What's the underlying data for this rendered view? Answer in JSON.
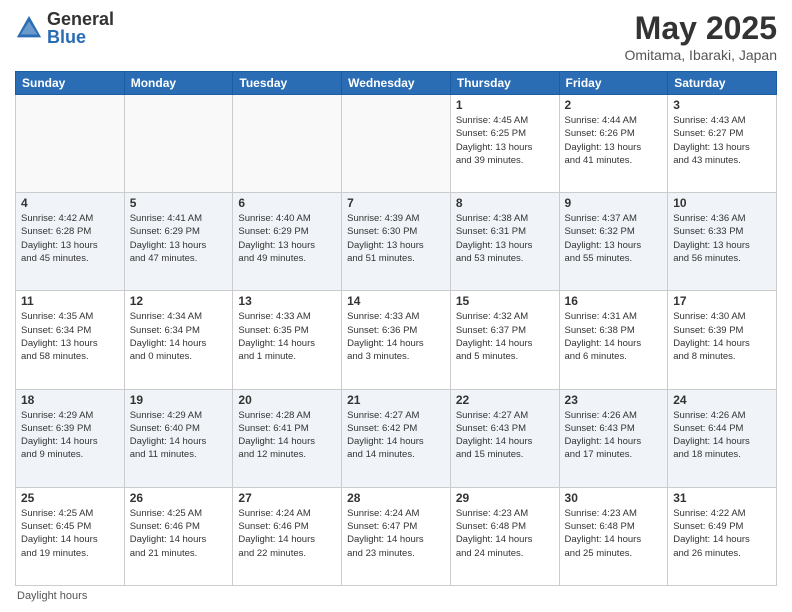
{
  "header": {
    "logo": {
      "general": "General",
      "blue": "Blue"
    },
    "title": "May 2025",
    "location": "Omitama, Ibaraki, Japan"
  },
  "days_of_week": [
    "Sunday",
    "Monday",
    "Tuesday",
    "Wednesday",
    "Thursday",
    "Friday",
    "Saturday"
  ],
  "weeks": [
    [
      {
        "day": "",
        "info": ""
      },
      {
        "day": "",
        "info": ""
      },
      {
        "day": "",
        "info": ""
      },
      {
        "day": "",
        "info": ""
      },
      {
        "day": "1",
        "info": "Sunrise: 4:45 AM\nSunset: 6:25 PM\nDaylight: 13 hours\nand 39 minutes."
      },
      {
        "day": "2",
        "info": "Sunrise: 4:44 AM\nSunset: 6:26 PM\nDaylight: 13 hours\nand 41 minutes."
      },
      {
        "day": "3",
        "info": "Sunrise: 4:43 AM\nSunset: 6:27 PM\nDaylight: 13 hours\nand 43 minutes."
      }
    ],
    [
      {
        "day": "4",
        "info": "Sunrise: 4:42 AM\nSunset: 6:28 PM\nDaylight: 13 hours\nand 45 minutes."
      },
      {
        "day": "5",
        "info": "Sunrise: 4:41 AM\nSunset: 6:29 PM\nDaylight: 13 hours\nand 47 minutes."
      },
      {
        "day": "6",
        "info": "Sunrise: 4:40 AM\nSunset: 6:29 PM\nDaylight: 13 hours\nand 49 minutes."
      },
      {
        "day": "7",
        "info": "Sunrise: 4:39 AM\nSunset: 6:30 PM\nDaylight: 13 hours\nand 51 minutes."
      },
      {
        "day": "8",
        "info": "Sunrise: 4:38 AM\nSunset: 6:31 PM\nDaylight: 13 hours\nand 53 minutes."
      },
      {
        "day": "9",
        "info": "Sunrise: 4:37 AM\nSunset: 6:32 PM\nDaylight: 13 hours\nand 55 minutes."
      },
      {
        "day": "10",
        "info": "Sunrise: 4:36 AM\nSunset: 6:33 PM\nDaylight: 13 hours\nand 56 minutes."
      }
    ],
    [
      {
        "day": "11",
        "info": "Sunrise: 4:35 AM\nSunset: 6:34 PM\nDaylight: 13 hours\nand 58 minutes."
      },
      {
        "day": "12",
        "info": "Sunrise: 4:34 AM\nSunset: 6:34 PM\nDaylight: 14 hours\nand 0 minutes."
      },
      {
        "day": "13",
        "info": "Sunrise: 4:33 AM\nSunset: 6:35 PM\nDaylight: 14 hours\nand 1 minute."
      },
      {
        "day": "14",
        "info": "Sunrise: 4:33 AM\nSunset: 6:36 PM\nDaylight: 14 hours\nand 3 minutes."
      },
      {
        "day": "15",
        "info": "Sunrise: 4:32 AM\nSunset: 6:37 PM\nDaylight: 14 hours\nand 5 minutes."
      },
      {
        "day": "16",
        "info": "Sunrise: 4:31 AM\nSunset: 6:38 PM\nDaylight: 14 hours\nand 6 minutes."
      },
      {
        "day": "17",
        "info": "Sunrise: 4:30 AM\nSunset: 6:39 PM\nDaylight: 14 hours\nand 8 minutes."
      }
    ],
    [
      {
        "day": "18",
        "info": "Sunrise: 4:29 AM\nSunset: 6:39 PM\nDaylight: 14 hours\nand 9 minutes."
      },
      {
        "day": "19",
        "info": "Sunrise: 4:29 AM\nSunset: 6:40 PM\nDaylight: 14 hours\nand 11 minutes."
      },
      {
        "day": "20",
        "info": "Sunrise: 4:28 AM\nSunset: 6:41 PM\nDaylight: 14 hours\nand 12 minutes."
      },
      {
        "day": "21",
        "info": "Sunrise: 4:27 AM\nSunset: 6:42 PM\nDaylight: 14 hours\nand 14 minutes."
      },
      {
        "day": "22",
        "info": "Sunrise: 4:27 AM\nSunset: 6:43 PM\nDaylight: 14 hours\nand 15 minutes."
      },
      {
        "day": "23",
        "info": "Sunrise: 4:26 AM\nSunset: 6:43 PM\nDaylight: 14 hours\nand 17 minutes."
      },
      {
        "day": "24",
        "info": "Sunrise: 4:26 AM\nSunset: 6:44 PM\nDaylight: 14 hours\nand 18 minutes."
      }
    ],
    [
      {
        "day": "25",
        "info": "Sunrise: 4:25 AM\nSunset: 6:45 PM\nDaylight: 14 hours\nand 19 minutes."
      },
      {
        "day": "26",
        "info": "Sunrise: 4:25 AM\nSunset: 6:46 PM\nDaylight: 14 hours\nand 21 minutes."
      },
      {
        "day": "27",
        "info": "Sunrise: 4:24 AM\nSunset: 6:46 PM\nDaylight: 14 hours\nand 22 minutes."
      },
      {
        "day": "28",
        "info": "Sunrise: 4:24 AM\nSunset: 6:47 PM\nDaylight: 14 hours\nand 23 minutes."
      },
      {
        "day": "29",
        "info": "Sunrise: 4:23 AM\nSunset: 6:48 PM\nDaylight: 14 hours\nand 24 minutes."
      },
      {
        "day": "30",
        "info": "Sunrise: 4:23 AM\nSunset: 6:48 PM\nDaylight: 14 hours\nand 25 minutes."
      },
      {
        "day": "31",
        "info": "Sunrise: 4:22 AM\nSunset: 6:49 PM\nDaylight: 14 hours\nand 26 minutes."
      }
    ]
  ],
  "footer": "Daylight hours"
}
